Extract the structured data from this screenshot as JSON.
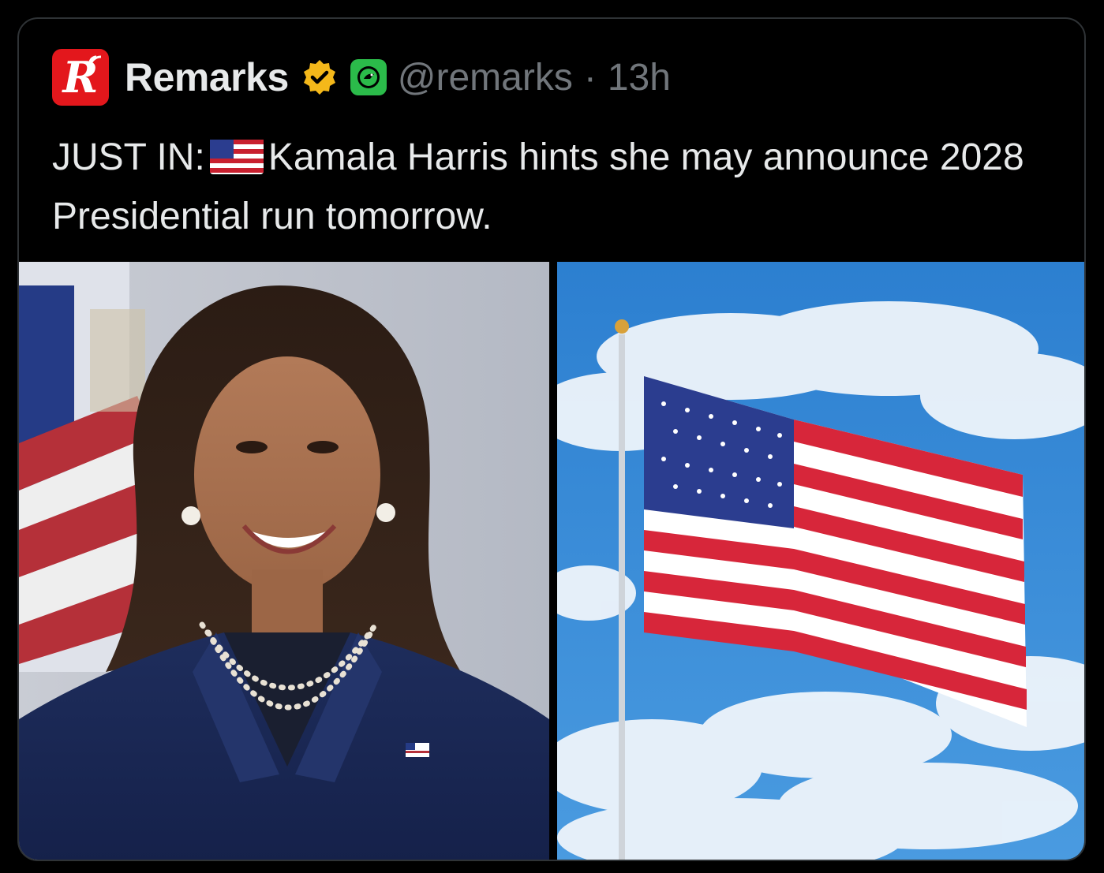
{
  "post": {
    "display_name": "Remarks",
    "logo_letter": "R",
    "handle": "@remarks",
    "separator": "·",
    "time": "13h",
    "verified_icon": "verified-badge-icon",
    "affiliate_icon": "affiliate-badge-icon",
    "text_before_flag": "JUST IN:",
    "text_after_flag": "Kamala Harris hints she may announce 2028 Presidential run tomorrow."
  },
  "colors": {
    "brand_red": "#e3171c",
    "verified_gold": "#f4b81a",
    "affiliate_green": "#2bbb4a",
    "text_primary": "#e7e9ea",
    "text_secondary": "#71767b"
  },
  "media": {
    "left_image": "portrait-photo",
    "right_image": "american-flag-photo"
  }
}
